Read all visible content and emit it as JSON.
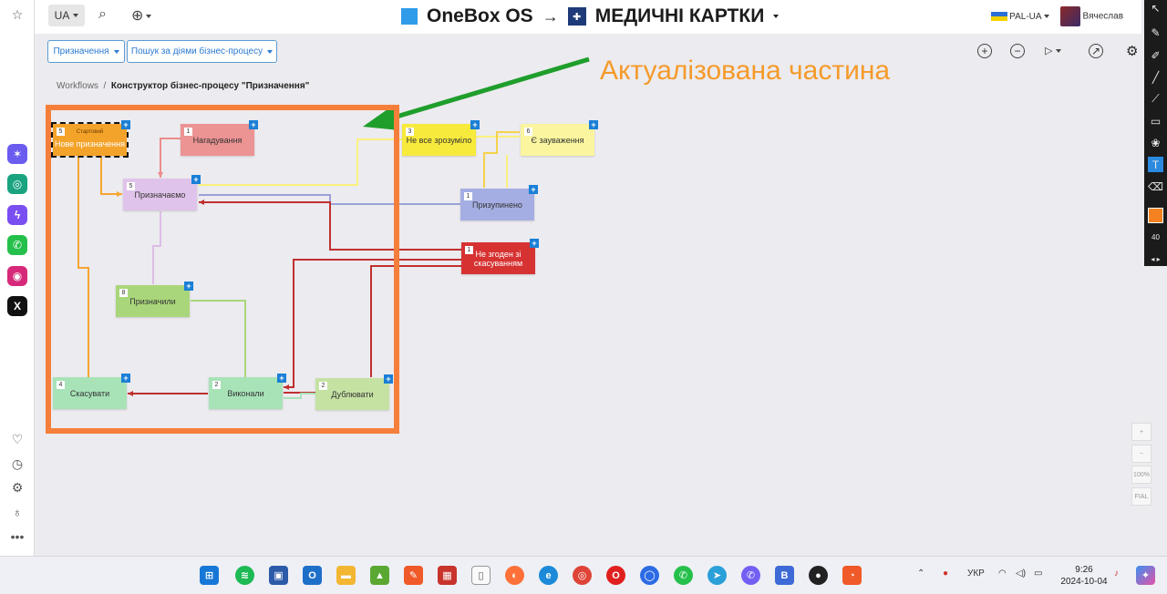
{
  "topbar": {
    "lang": "UA",
    "app_name": "OneBox OS",
    "arrow": "→",
    "section_title": "МЕДИЧНІ КАРТКИ",
    "locale": "PAL-UA",
    "user_name": "Вячеслав"
  },
  "filters": {
    "assignments_label": "Призначення",
    "search_label": "Пошук за діями бізнес-процесу"
  },
  "breadcrumb": {
    "root": "Workflows",
    "separator": "/",
    "current": "Конструктор бізнес-процесу \"Призначення\""
  },
  "annotation": "Актуалізована частина",
  "nodes": [
    {
      "id": "new",
      "num": "5",
      "tag": "Стартовий",
      "label": "Нове призначення",
      "color": "#f4a32a"
    },
    {
      "id": "reminder",
      "num": "1",
      "label": "Нагадування",
      "color": "#ec9393"
    },
    {
      "id": "assigning",
      "num": "5",
      "label": "Призначаємо",
      "color": "#e0c3ea"
    },
    {
      "id": "unclear",
      "num": "3",
      "label": "Не все зрозуміло",
      "color": "#f8ea3c"
    },
    {
      "id": "remarks",
      "num": "6",
      "label": "Є зауваження",
      "color": "#faf59e"
    },
    {
      "id": "paused",
      "num": "1",
      "label": "Призупинено",
      "color": "#a5aee3"
    },
    {
      "id": "disagree",
      "num": "1",
      "label": "Не згоден зі скасуванням",
      "color": "#d63232"
    },
    {
      "id": "assigned",
      "num": "8",
      "label": "Призначили",
      "color": "#a9d67a"
    },
    {
      "id": "cancel",
      "num": "4",
      "label": "Скасувати",
      "color": "#a8e3b8"
    },
    {
      "id": "done",
      "num": "2",
      "label": "Виконали",
      "color": "#a8e3b8"
    },
    {
      "id": "duplicate",
      "num": "2",
      "label": "Дублювати",
      "color": "#c5e2a3"
    }
  ],
  "zoom": {
    "plus": "+",
    "minus": "−",
    "percent": "100%",
    "fit": "FIAL"
  },
  "drawbar": {
    "size_value": "40"
  },
  "taskbar": {
    "language": "УКР",
    "time": "9:26",
    "date": "2024-10-04"
  }
}
